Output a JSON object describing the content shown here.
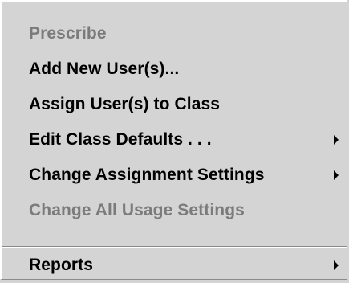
{
  "menu": {
    "items": [
      {
        "label": "Prescribe",
        "enabled": false,
        "submenu": false
      },
      {
        "label": "Add New User(s)...",
        "enabled": true,
        "submenu": false
      },
      {
        "label": "Assign User(s) to Class",
        "enabled": true,
        "submenu": false
      },
      {
        "label": "Edit Class Defaults . . .",
        "enabled": true,
        "submenu": true
      },
      {
        "label": "Change Assignment Settings",
        "enabled": true,
        "submenu": true
      },
      {
        "label": "Change All Usage Settings",
        "enabled": false,
        "submenu": false
      },
      {
        "label": "Reports",
        "enabled": true,
        "submenu": true
      }
    ]
  },
  "colors": {
    "background": "#d4d4d4",
    "enabled_text": "#000000",
    "disabled_text": "#7b7b7b",
    "separator_dark": "#8a8a8a",
    "separator_light": "#ffffff"
  },
  "icons": {
    "submenu": "submenu-arrow-icon"
  }
}
